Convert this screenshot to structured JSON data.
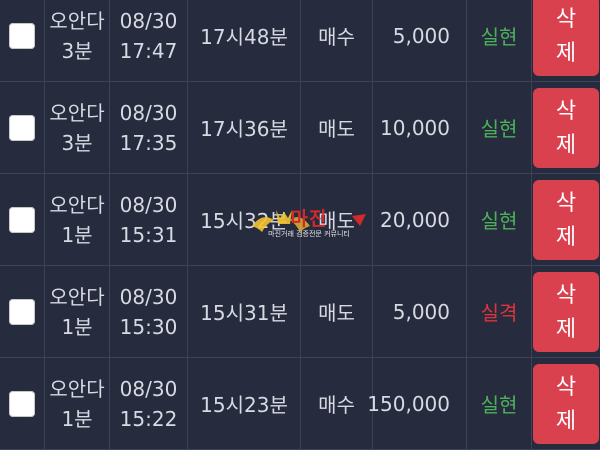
{
  "colors": {
    "background": "#262b3d",
    "delete_button": "#d9414f",
    "result_win": "#4cb25a",
    "result_lose": "#e0333a",
    "checkbox": "#ffffff"
  },
  "rows": [
    {
      "game": [
        "오안다",
        "3분"
      ],
      "date": "08/30",
      "time": "17:47",
      "round": "17시48분",
      "type": "매수",
      "amount": "5,000",
      "result": "실현",
      "result_status": "win",
      "delete": [
        "삭",
        "제"
      ]
    },
    {
      "game": [
        "오안다",
        "3분"
      ],
      "date": "08/30",
      "time": "17:35",
      "round": "17시36분",
      "type": "매도",
      "amount": "10,000",
      "result": "실현",
      "result_status": "win",
      "delete": [
        "삭",
        "제"
      ]
    },
    {
      "game": [
        "오안다",
        "1분"
      ],
      "date": "08/30",
      "time": "15:31",
      "round": "15시32분",
      "type": "매도",
      "amount": "20,000",
      "result": "실현",
      "result_status": "win",
      "delete": [
        "삭",
        "제"
      ]
    },
    {
      "game": [
        "오안다",
        "1분"
      ],
      "date": "08/30",
      "time": "15:30",
      "round": "15시31분",
      "type": "매도",
      "amount": "5,000",
      "result": "실격",
      "result_status": "lose",
      "delete": [
        "삭",
        "제"
      ]
    },
    {
      "game": [
        "오안다",
        "1분"
      ],
      "date": "08/30",
      "time": "15:22",
      "round": "15시23분",
      "type": "매수",
      "amount": "150,000",
      "result": "실현",
      "result_status": "win",
      "delete": [
        "삭",
        "제"
      ]
    }
  ],
  "watermark": {
    "main": "마진",
    "sub": "마진거래 검증전문 커뮤니티"
  }
}
